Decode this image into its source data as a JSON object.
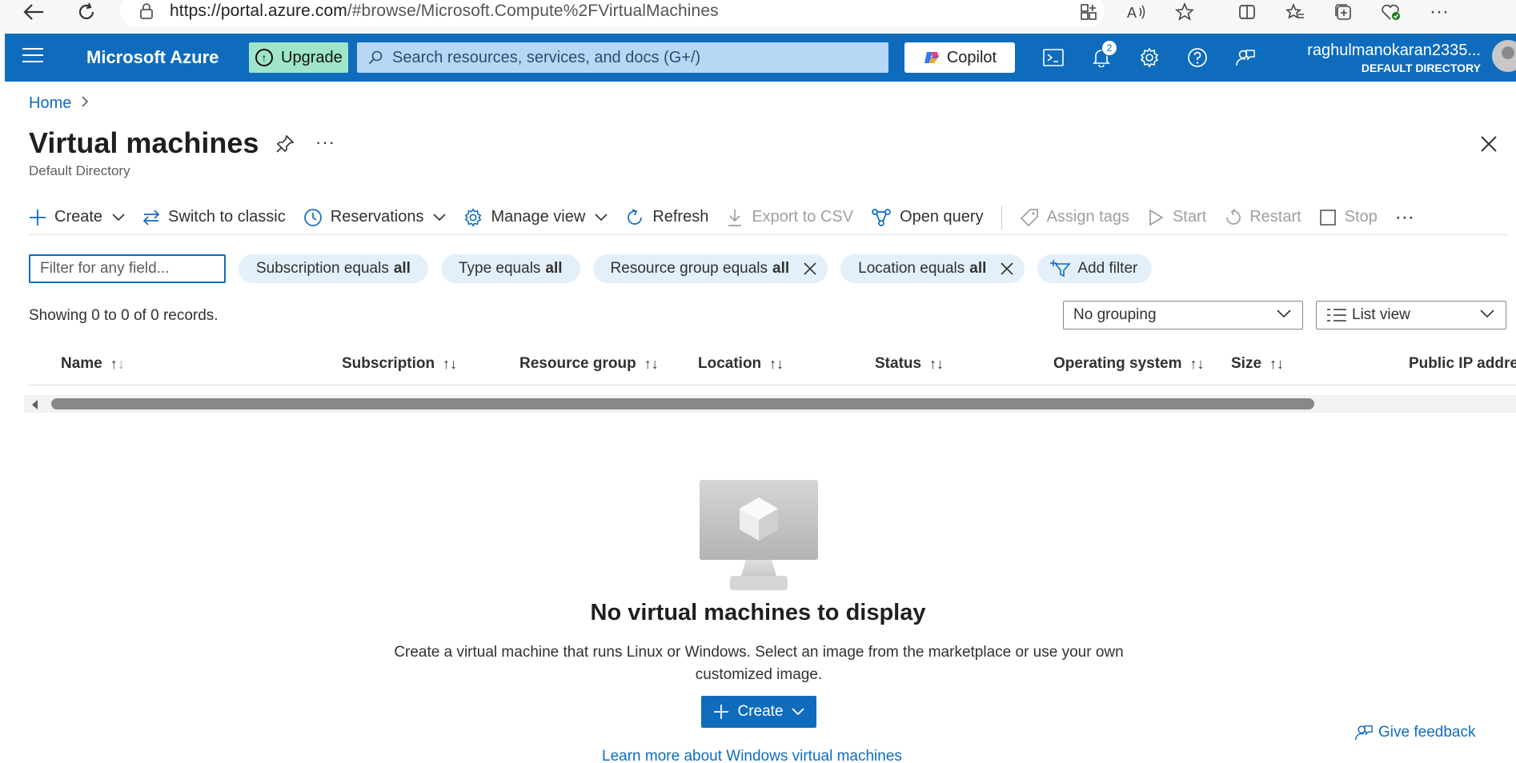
{
  "browser": {
    "url_host": "https://portal.azure.com",
    "url_path": "/#browse/Microsoft.Compute%2FVirtualMachines",
    "icons": [
      "back-icon",
      "refresh-icon",
      "lock-icon",
      "apps-icon",
      "read-aloud-icon",
      "favorite-icon",
      "split-screen-icon",
      "favorites-icon",
      "collections-icon",
      "browser-essentials-icon",
      "more-icon"
    ]
  },
  "header": {
    "brand": "Microsoft Azure",
    "upgrade_label": "Upgrade",
    "search_placeholder": "Search resources, services, and docs (G+/)",
    "copilot_label": "Copilot",
    "notification_count": "2",
    "account_name": "raghulmanokaran2335...",
    "account_directory": "DEFAULT DIRECTORY",
    "accent_color": "#0f6cbd"
  },
  "breadcrumb": {
    "home": "Home"
  },
  "page": {
    "title": "Virtual machines",
    "subtitle": "Default Directory"
  },
  "commands": {
    "create": "Create",
    "switch_classic": "Switch to classic",
    "reservations": "Reservations",
    "manage_view": "Manage view",
    "refresh": "Refresh",
    "export_csv": "Export to CSV",
    "open_query": "Open query",
    "assign_tags": "Assign tags",
    "start": "Start",
    "restart": "Restart",
    "stop": "Stop",
    "more": "···"
  },
  "filters": {
    "placeholder": "Filter for any field...",
    "pills": [
      {
        "label": "Subscription equals",
        "value": "all"
      },
      {
        "label": "Type equals",
        "value": "all"
      },
      {
        "label": "Resource group equals",
        "value": "all"
      },
      {
        "label": "Location equals",
        "value": "all"
      }
    ],
    "add_filter": "Add filter"
  },
  "records": {
    "count_text": "Showing 0 to 0 of 0 records.",
    "grouping": "No grouping",
    "view": "List view"
  },
  "table": {
    "columns": [
      "Name",
      "Subscription",
      "Resource group",
      "Location",
      "Status",
      "Operating system",
      "Size",
      "Public IP address"
    ]
  },
  "empty_state": {
    "title": "No virtual machines to display",
    "description": "Create a virtual machine that runs Linux or Windows. Select an image from the marketplace or use your own customized image.",
    "create_label": "Create",
    "learn_more": "Learn more about Windows virtual machines"
  },
  "feedback": {
    "label": "Give feedback"
  }
}
